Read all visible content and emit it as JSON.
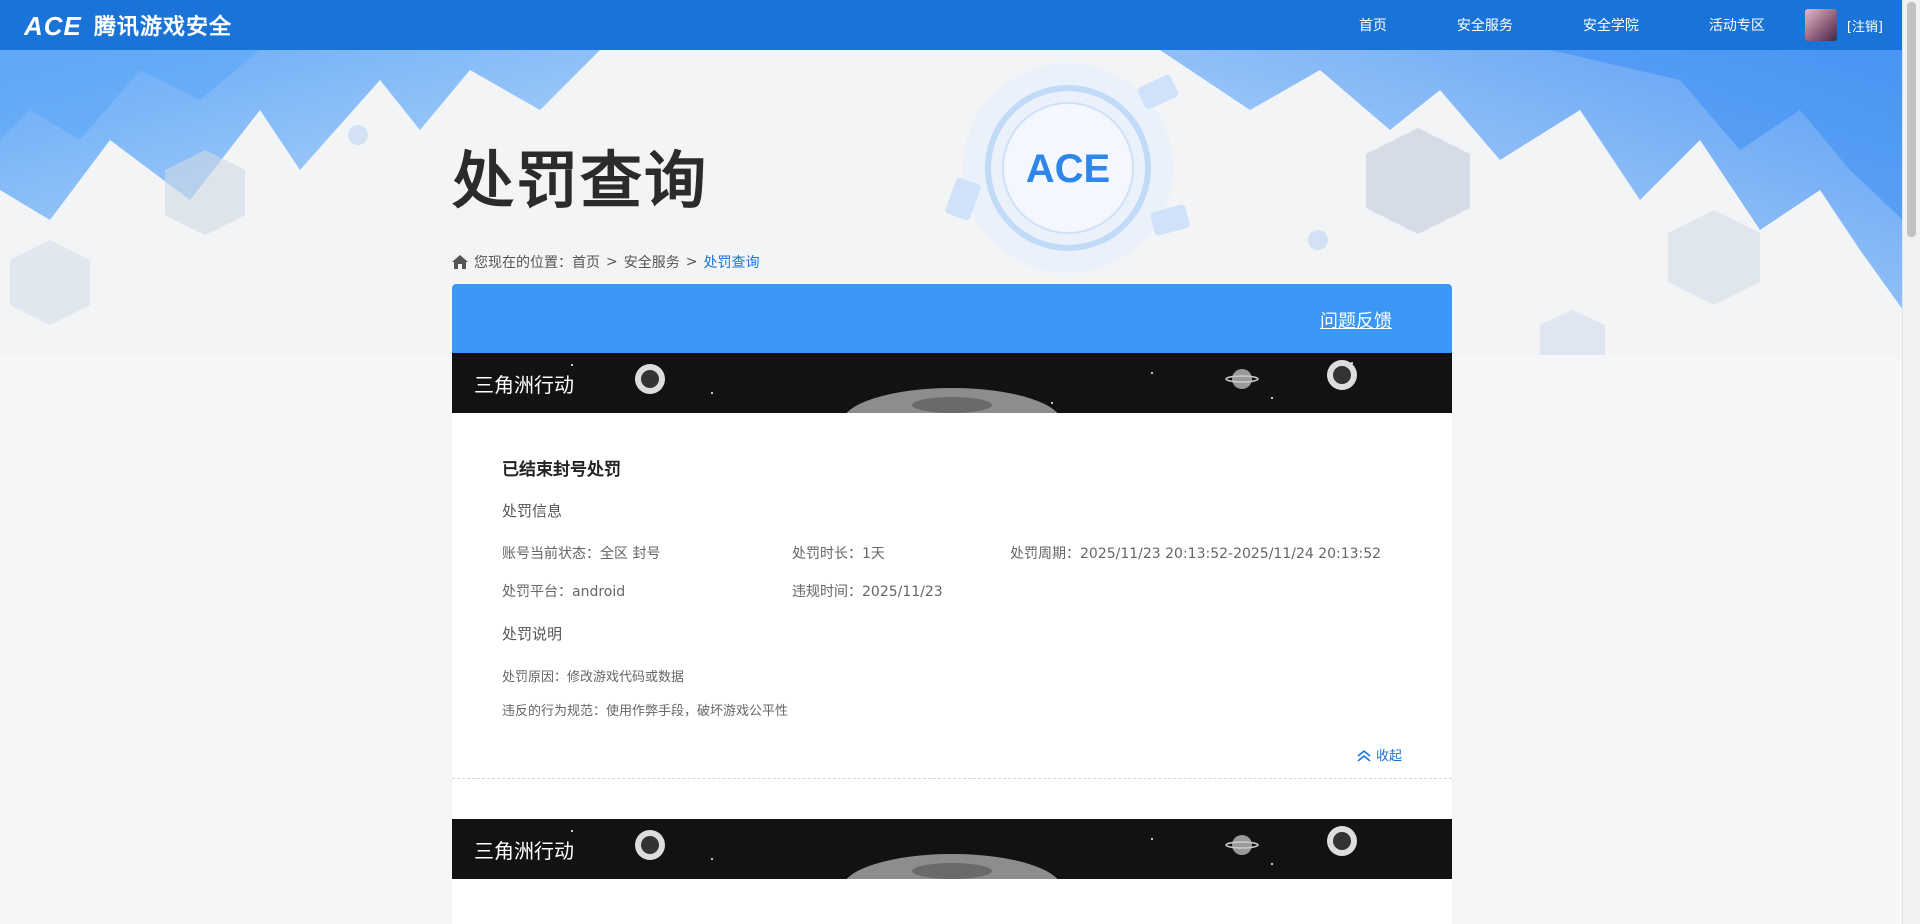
{
  "nav": {
    "brand": "腾讯游戏安全",
    "items": [
      "首页",
      "安全服务",
      "安全学院",
      "活动专区"
    ],
    "logout": "[注销]"
  },
  "page": {
    "title": "处罚查询",
    "breadcrumb": {
      "prefix": "您现在的位置：",
      "home": "首页",
      "sep1": ">",
      "service": "安全服务",
      "sep2": ">",
      "current": "处罚查询"
    }
  },
  "panel": {
    "feedback": "问题反馈",
    "records": [
      {
        "game": "三角洲行动",
        "status_title": "已结束封号处罚",
        "info_title": "处罚信息",
        "account_state": "账号当前状态：全区 封号",
        "duration": "处罚时长：1天",
        "period": "处罚周期：2025/11/23 20:13:52-2025/11/24 20:13:52",
        "platform": "处罚平台：android",
        "violation_time": "违规时间：2025/11/23",
        "desc_title": "处罚说明",
        "reason": "处罚原因：修改游戏代码或数据",
        "rule": "违反的行为规范：使用作弊手段，破坏游戏公平性",
        "collapse": "收起"
      },
      {
        "game": "三角洲行动"
      }
    ]
  },
  "colors": {
    "nav_bg": "#1a74d8",
    "panel_head": "#3a97f5",
    "link": "#1a74d8"
  }
}
